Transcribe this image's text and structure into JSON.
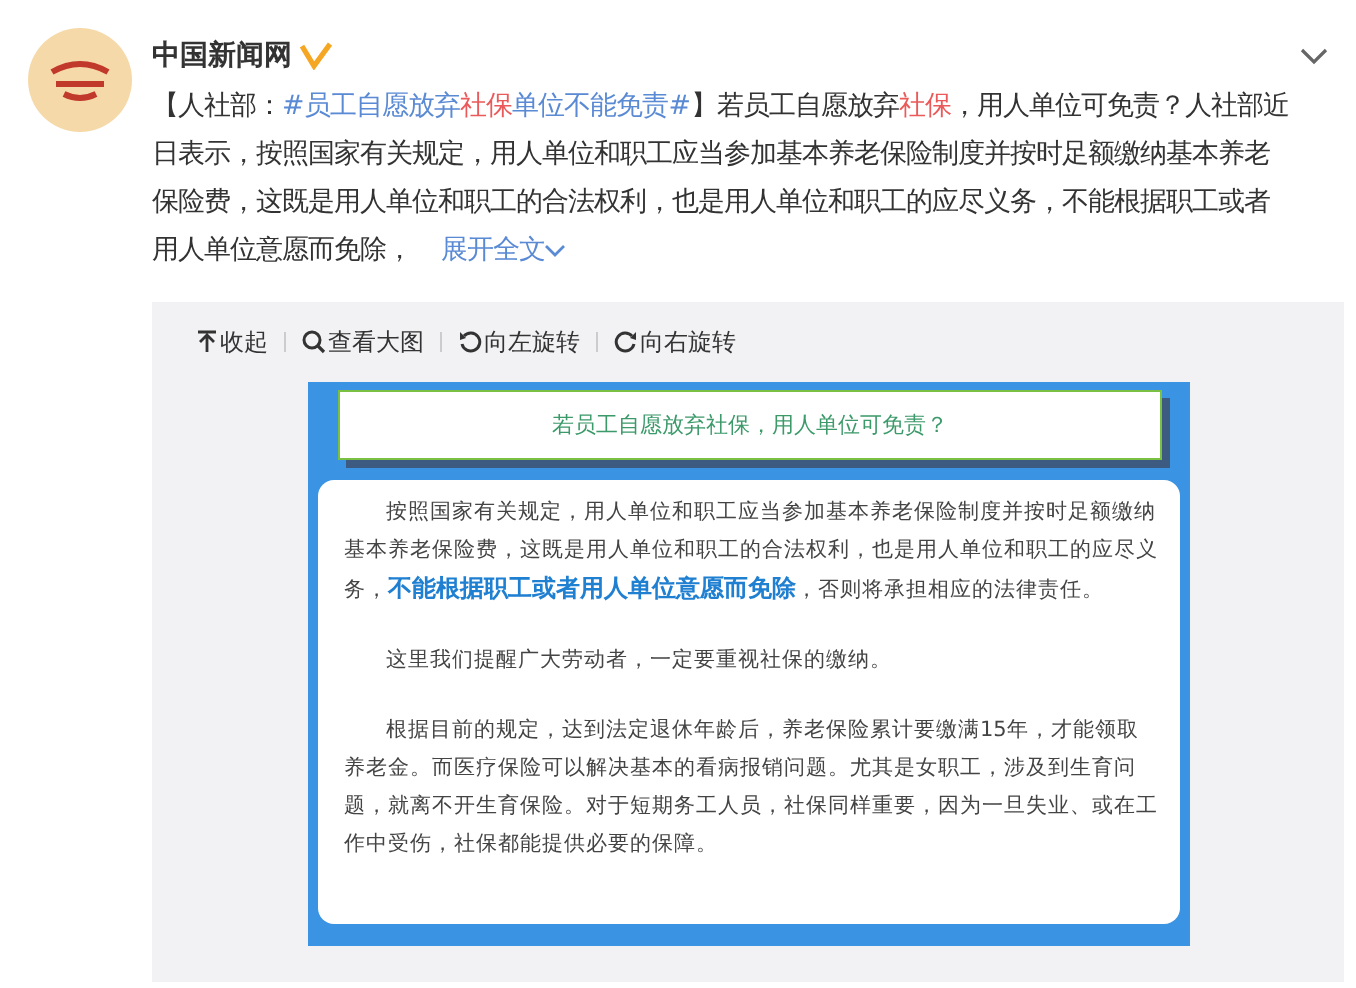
{
  "post": {
    "author": "中国新闻网",
    "verified": true,
    "body": [
      {
        "kind": "text",
        "text": "【人社部："
      },
      {
        "kind": "hashtag",
        "parts": [
          {
            "kind": "plain",
            "text": "#员工自愿放弃"
          },
          {
            "kind": "keyword",
            "text": "社保"
          },
          {
            "kind": "plain",
            "text": "单位不能免责#"
          }
        ]
      },
      {
        "kind": "text",
        "text": "】若员工自愿放弃"
      },
      {
        "kind": "keyword",
        "text": "社保"
      },
      {
        "kind": "text",
        "text": "，用人单位可免责？人社部近日表示，按照国家有关规定，用人单位和职工应当参加基本养老保险制度并按时足额缴纳基本养老保险费，这既是用人单位和职工的合法权利，也是用人单位和职工的应尽义务，不能根据职工或者用人单位意愿而免除， "
      }
    ],
    "expand": "展开全文"
  },
  "image_toolbar": [
    {
      "kind": "collapse",
      "label": "收起"
    },
    {
      "kind": "zoom",
      "label": "查看大图"
    },
    {
      "kind": "rotate-left",
      "label": "向左旋转"
    },
    {
      "kind": "rotate-right",
      "label": "向右旋转"
    }
  ],
  "image": {
    "title": "若员工自愿放弃社保，用人单位可免责？",
    "paragraphs": [
      "按照国家有关规定，用人单位和职工应当参加基本养老保险制度并按时足额缴纳基本养老保险费，这既是用人单位和职工的合法权利，也是用人单位和职工的应尽义务，**不能根据职工或者用人单位意愿而免除**，否则将承担相应的法律责任。",
      "这里我们提醒广大劳动者，一定要重视社保的缴纳。",
      "根据目前的规定，达到法定退休年龄后，养老保险累计要缴满15年，才能领取养老金。而医疗保险可以解决基本的看病报销问题。尤其是女职工，涉及到生育问题，就离不开生育保险。对于短期务工人员，社保同样重要，因为一旦失业、或在工作中受伤，社保都能提供必要的保障。"
    ]
  }
}
